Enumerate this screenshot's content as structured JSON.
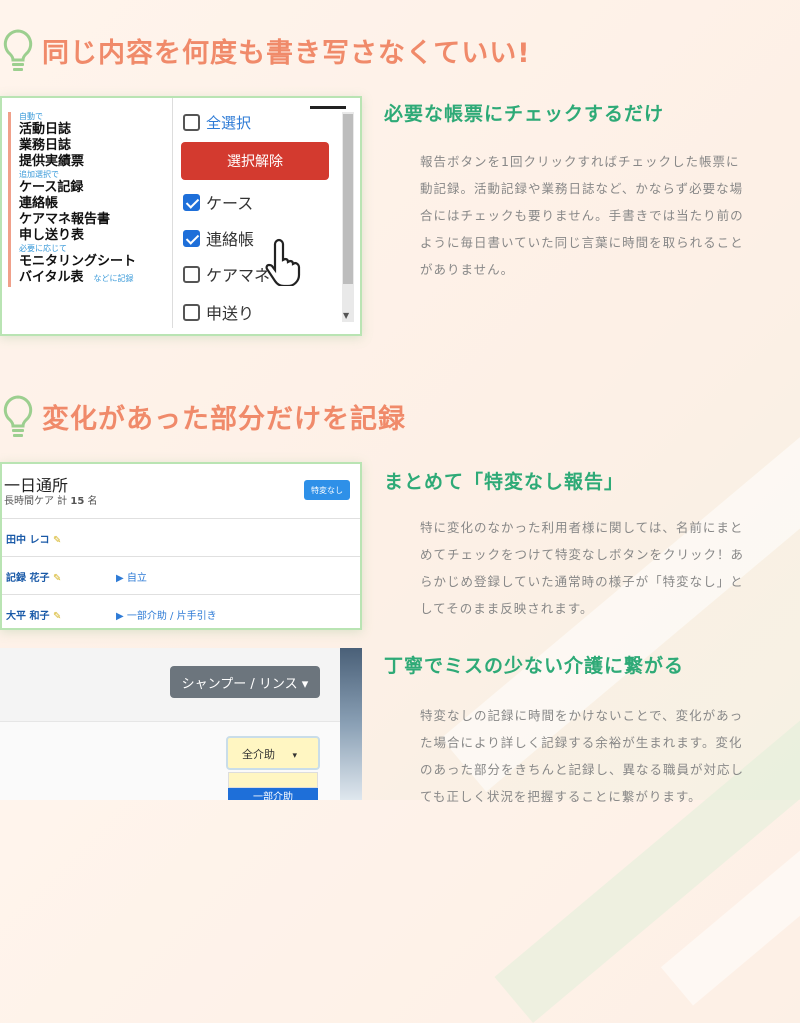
{
  "section1": {
    "title": "同じ内容を何度も書き写さなくていい!"
  },
  "card1": {
    "groups": [
      {
        "label": "自動で",
        "items": [
          "活動日誌",
          "業務日誌",
          "提供実績票"
        ]
      },
      {
        "label": "追加選択で",
        "items": [
          "ケース記録",
          "連絡帳",
          "ケアマネ報告書",
          "申し送り表"
        ]
      },
      {
        "label": "必要に応じて",
        "items": [
          "モニタリングシート",
          "バイタル表"
        ]
      }
    ],
    "etc_note": "などに記録",
    "select_all_label": "全選択",
    "deselect_button": "選択解除",
    "checkboxes": [
      "ケース",
      "連絡帳",
      "ケアマネ",
      "申送り"
    ]
  },
  "feature1": {
    "heading": "必要な帳票にチェックするだけ",
    "lines": [
      "報告ボタンを1回クリックすればチェックした帳票に",
      "動記録。活動記録や業務日誌など、かならず必要な場",
      "合にはチェックも要りません。手書きでは当たり前の",
      "ように毎日書いていた同じ言葉に時間を取られること",
      "がありません。"
    ]
  },
  "section2": {
    "title": "変化があった部分だけを記録"
  },
  "card2": {
    "title": "一日通所",
    "subtitle_prefix": "長時間ケア 計",
    "count": "15",
    "count_unit": "名",
    "button": "特変なし",
    "rows": [
      {
        "name": "田中 レコ",
        "note": ""
      },
      {
        "name": "記録 花子",
        "note": "▶ 自立"
      },
      {
        "name": "大平 和子",
        "note": "▶ 一部介助 / 片手引き"
      }
    ]
  },
  "feature2": {
    "heading": "まとめて「特変なし報告」",
    "lines": [
      "特に変化のなかった利用者様に関しては、名前にまと",
      "めてチェックをつけて特変なしボタンをクリック！あ",
      "らかじめ登録していた通常時の様子が「特変なし」と",
      "してそのまま反映されます。"
    ]
  },
  "card3": {
    "dropdown_button": "シャンプー / リンス ▾",
    "select_value": "全介助",
    "option_selected": "一部介助"
  },
  "feature3": {
    "heading": "丁寧でミスの少ない介護に繋がる",
    "lines": [
      "特変なしの記録に時間をかけないことで、変化があっ",
      "た場合により詳しく記録する余裕が生まれます。変化",
      "のあった部分をきちんと記録し、異なる職員が対応し",
      "ても正しく状況を把握することに繋がります。"
    ]
  },
  "colors": {
    "accent": "#f08a6a",
    "green": "#2eaa77",
    "bulb": "#9ccf8f"
  }
}
